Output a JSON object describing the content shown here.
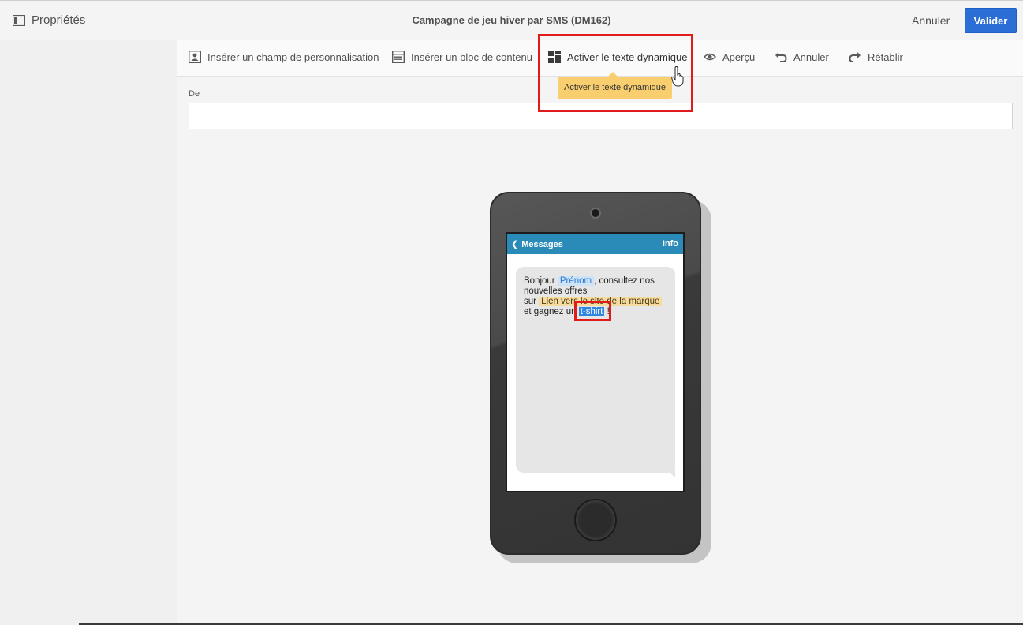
{
  "header": {
    "properties_label": "Propriétés",
    "title": "Campagne de jeu hiver par SMS (DM162)",
    "cancel_label": "Annuler",
    "validate_label": "Valider"
  },
  "toolbar": {
    "items": [
      {
        "label": "Insérer un champ de personnalisation",
        "icon": "personalization-field-icon"
      },
      {
        "label": "Insérer un bloc de contenu",
        "icon": "content-block-icon"
      },
      {
        "label": "Activer le texte dynamique",
        "icon": "dynamic-text-icon"
      },
      {
        "label": "Aperçu",
        "icon": "eye-icon"
      },
      {
        "label": "Annuler",
        "icon": "undo-icon"
      },
      {
        "label": "Rétablir",
        "icon": "redo-icon"
      }
    ],
    "tooltip": "Activer le texte dynamique"
  },
  "form": {
    "from_label": "De",
    "from_value": ""
  },
  "phone": {
    "messages_label": "Messages",
    "info_label": "Info",
    "message": {
      "part1": "Bonjour ",
      "tag_firstname": "Prénom",
      "part2": ", consultez nos nouvelles offres",
      "part3": "sur ",
      "tag_link": "Lien vers le site de la marque",
      "part4": "et gagnez un ",
      "tag_selected": "t-shirt",
      "part5": " !"
    }
  },
  "colors": {
    "accent_button": "#2b6fd6",
    "annotation": "#e01b1b",
    "tooltip": "#f8ce6e",
    "messages_bar": "#2a8ab8"
  }
}
